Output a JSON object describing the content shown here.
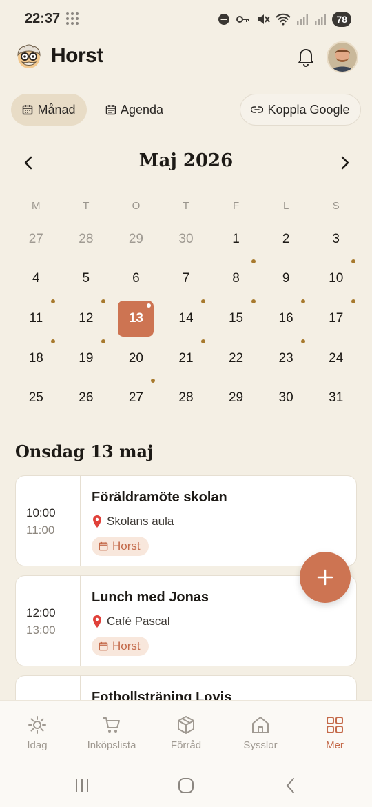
{
  "status_bar": {
    "time": "22:37",
    "battery": "78"
  },
  "header": {
    "app_title": "Horst"
  },
  "view_toggle": {
    "month": "Månad",
    "agenda": "Agenda",
    "google": "Koppla Google"
  },
  "calendar": {
    "month_title": "Maj 2026",
    "weekdays": [
      "M",
      "T",
      "O",
      "T",
      "F",
      "L",
      "S"
    ],
    "days": [
      {
        "n": "27",
        "muted": true
      },
      {
        "n": "28",
        "muted": true
      },
      {
        "n": "29",
        "muted": true
      },
      {
        "n": "30",
        "muted": true
      },
      {
        "n": "1"
      },
      {
        "n": "2"
      },
      {
        "n": "3"
      },
      {
        "n": "4"
      },
      {
        "n": "5"
      },
      {
        "n": "6"
      },
      {
        "n": "7"
      },
      {
        "n": "8",
        "dot": true
      },
      {
        "n": "9"
      },
      {
        "n": "10",
        "dot": true
      },
      {
        "n": "11",
        "dot": true
      },
      {
        "n": "12",
        "dot": true
      },
      {
        "n": "13",
        "today": true,
        "dot": true
      },
      {
        "n": "14",
        "dot": true
      },
      {
        "n": "15",
        "dot": true
      },
      {
        "n": "16",
        "dot": true
      },
      {
        "n": "17",
        "dot": true
      },
      {
        "n": "18",
        "dot": true
      },
      {
        "n": "19",
        "dot": true
      },
      {
        "n": "20"
      },
      {
        "n": "21",
        "dot": true
      },
      {
        "n": "22"
      },
      {
        "n": "23",
        "dot": true
      },
      {
        "n": "24"
      },
      {
        "n": "25"
      },
      {
        "n": "26"
      },
      {
        "n": "27",
        "dot": true
      },
      {
        "n": "28"
      },
      {
        "n": "29"
      },
      {
        "n": "30"
      },
      {
        "n": "31"
      }
    ]
  },
  "selected_day": {
    "heading": "Onsdag 13 maj"
  },
  "events": [
    {
      "start": "10:00",
      "end": "11:00",
      "title": "Föräldramöte skolan",
      "location": "Skolans aula",
      "tag": "Horst"
    },
    {
      "start": "12:00",
      "end": "13:00",
      "title": "Lunch med Jonas",
      "location": "Café Pascal",
      "tag": "Horst"
    },
    {
      "title": "Fotbollsträning Lovis"
    }
  ],
  "bottom_nav": [
    {
      "label": "Idag",
      "icon": "sun-icon"
    },
    {
      "label": "Inköpslista",
      "icon": "cart-icon"
    },
    {
      "label": "Förråd",
      "icon": "box-icon"
    },
    {
      "label": "Sysslor",
      "icon": "home-icon"
    },
    {
      "label": "Mer",
      "icon": "grid-icon",
      "active": true
    }
  ],
  "colors": {
    "accent": "#cd7452",
    "background": "#f4efe4",
    "event_dot": "#a87a2e",
    "tag_bg": "#f8e7dc"
  }
}
